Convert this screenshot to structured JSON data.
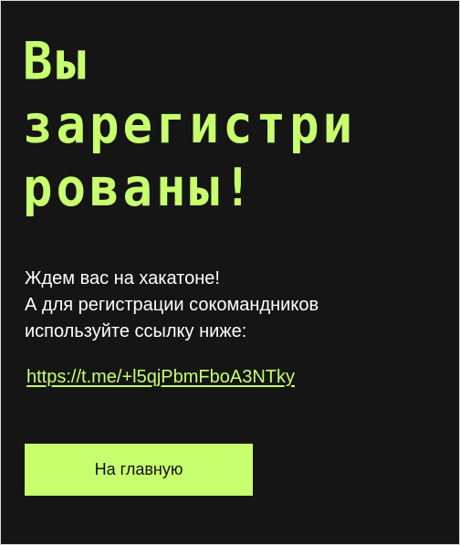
{
  "title": {
    "lines": [
      "Вы",
      "зарегистри",
      "рованы!"
    ]
  },
  "message": {
    "lines": [
      "Ждем вас на хакатоне!",
      "А для регистрации сокомандников",
      "используйте ссылку ниже:"
    ]
  },
  "invite_link": {
    "text": " https://t.me/+l5qjPbmFboA3NTky",
    "href": "https://t.me/+l5qjPbmFboA3NTky"
  },
  "home_button": {
    "label": "На главную"
  },
  "colors": {
    "background": "#151515",
    "accent": "#c8ff6e",
    "text": "#ffffff"
  }
}
